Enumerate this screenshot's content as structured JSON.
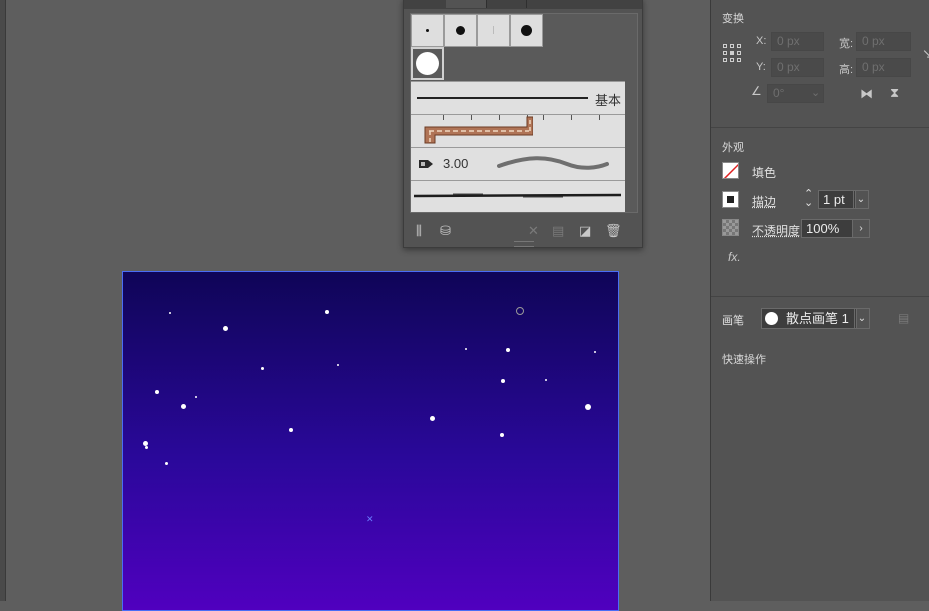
{
  "brushes": {
    "basic_label": "基本",
    "scatter_value": "3.00"
  },
  "properties": {
    "transform": {
      "title": "变换",
      "x_label": "X:",
      "y_label": "Y:",
      "w_label": "宽:",
      "h_label": "高:",
      "x_value": "0 px",
      "y_value": "0 px",
      "w_value": "0 px",
      "h_value": "0 px",
      "angle_value": "0°"
    },
    "appearance": {
      "title": "外观",
      "fill_label": "填色",
      "stroke_label": "描边",
      "stroke_value": "1 pt",
      "opacity_label": "不透明度",
      "opacity_value": "100%",
      "fx_label": "fx."
    },
    "brush": {
      "label": "画笔",
      "value": "散点画笔 1"
    },
    "quick_actions": {
      "title": "快速操作"
    }
  },
  "colors": {
    "artboard_top": "#0f0557",
    "artboard_bottom": "#5000bf",
    "artboard_border": "#4a6df5",
    "fill_none_slash": "#e02020"
  }
}
